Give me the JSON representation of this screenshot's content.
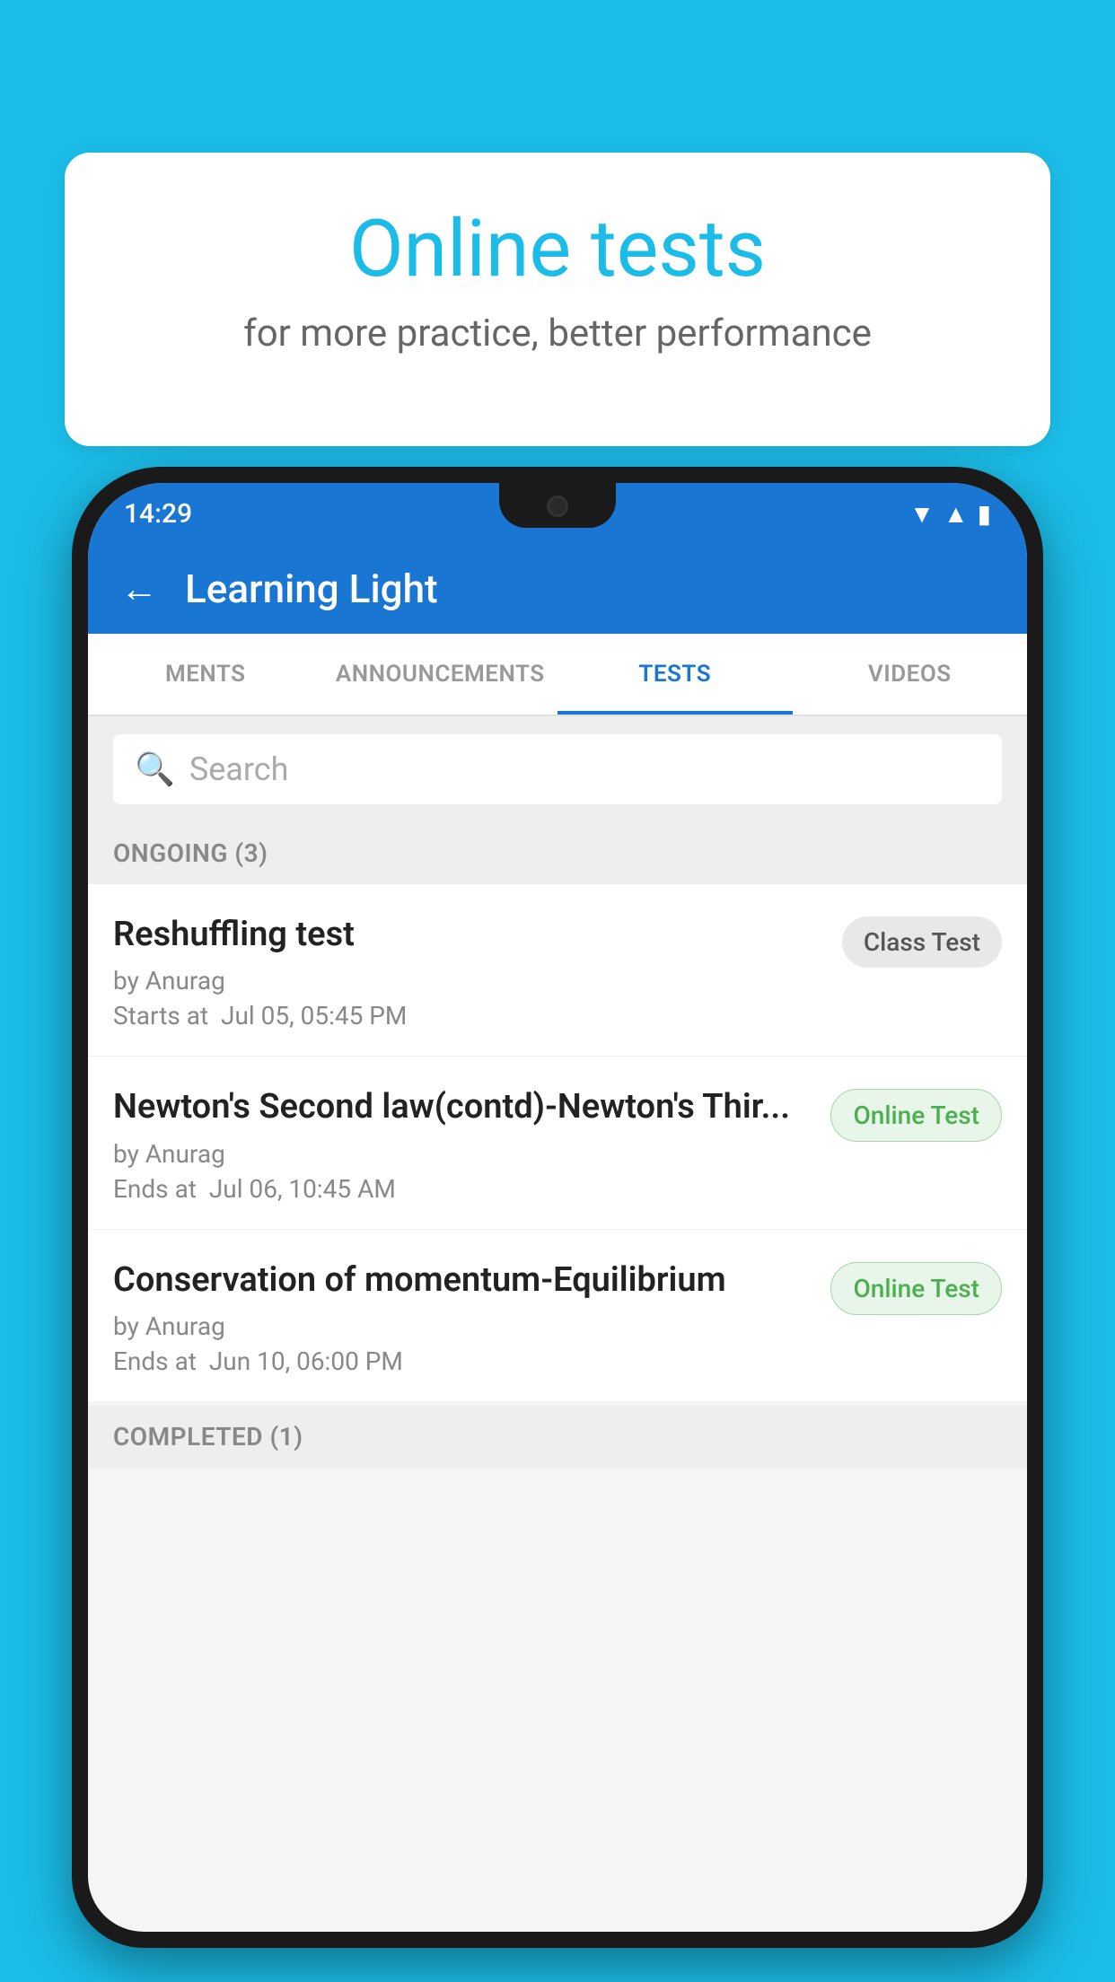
{
  "background": {
    "color": "#1BBDE8"
  },
  "speech_bubble": {
    "title": "Online tests",
    "subtitle": "for more practice, better performance"
  },
  "status_bar": {
    "time": "14:29",
    "wifi_icon": "▼",
    "signal_icon": "▲",
    "battery_icon": "▮"
  },
  "app_header": {
    "back_icon": "←",
    "title": "Learning Light"
  },
  "tabs": [
    {
      "label": "MENTS",
      "active": false
    },
    {
      "label": "ANNOUNCEMENTS",
      "active": false
    },
    {
      "label": "TESTS",
      "active": true
    },
    {
      "label": "VIDEOS",
      "active": false
    }
  ],
  "search": {
    "placeholder": "Search"
  },
  "ongoing_section": {
    "title": "ONGOING (3)"
  },
  "test_items": [
    {
      "name": "Reshuffling test",
      "author": "by Anurag",
      "time_label": "Starts at",
      "time_value": "Jul 05, 05:45 PM",
      "badge": "Class Test",
      "badge_type": "class"
    },
    {
      "name": "Newton's Second law(contd)-Newton's Thir...",
      "author": "by Anurag",
      "time_label": "Ends at",
      "time_value": "Jul 06, 10:45 AM",
      "badge": "Online Test",
      "badge_type": "online"
    },
    {
      "name": "Conservation of momentum-Equilibrium",
      "author": "by Anurag",
      "time_label": "Ends at",
      "time_value": "Jun 10, 06:00 PM",
      "badge": "Online Test",
      "badge_type": "online"
    }
  ],
  "completed_section": {
    "title": "COMPLETED (1)"
  }
}
